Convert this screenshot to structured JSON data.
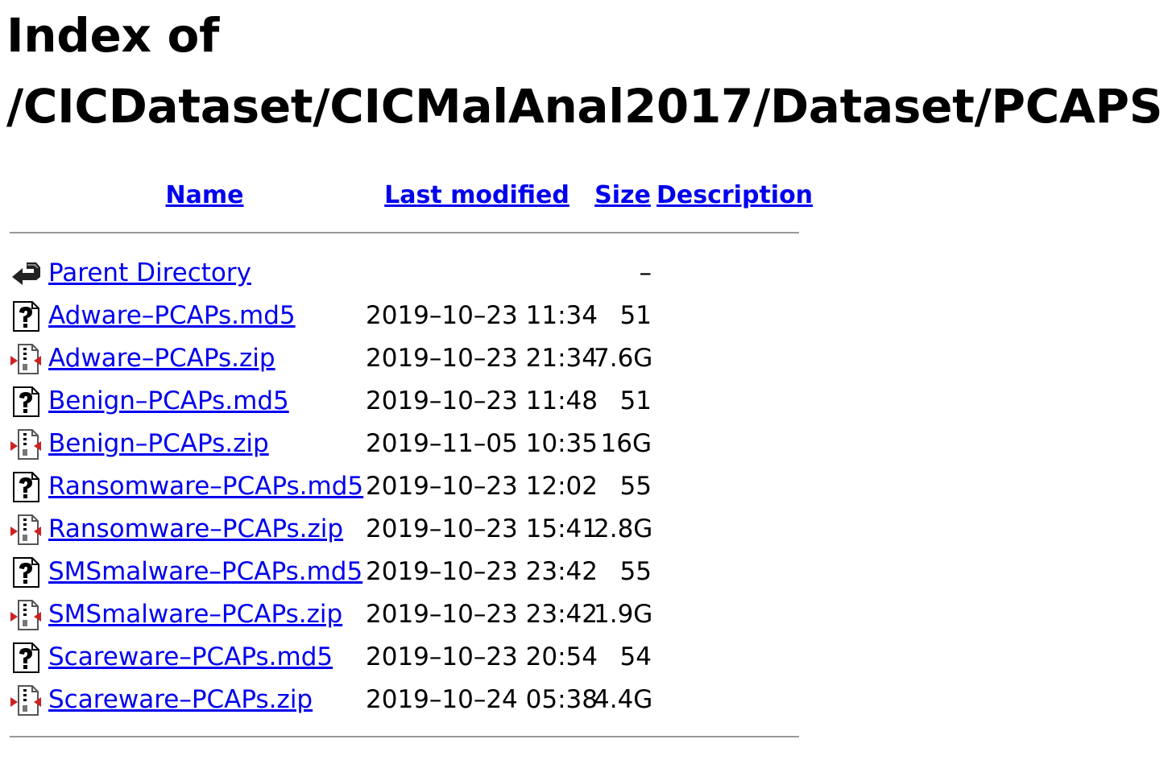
{
  "page": {
    "title_line1": "Index of",
    "title_line2": "/CICDataset/CICMalAnal2017/Dataset/PCAPS"
  },
  "columns": {
    "name": "Name",
    "last_modified": "Last modified",
    "size": "Size",
    "description": "Description"
  },
  "rows": [
    {
      "icon": "back-icon",
      "name": "Parent Directory",
      "date": "",
      "size": "–",
      "description": ""
    },
    {
      "icon": "unknown-file-icon",
      "name": "Adware–PCAPs.md5",
      "date": "2019–10–23 11:34",
      "size": "51",
      "description": ""
    },
    {
      "icon": "compressed-file-icon",
      "name": "Adware–PCAPs.zip",
      "date": "2019–10–23 21:34",
      "size": "7.6G",
      "description": ""
    },
    {
      "icon": "unknown-file-icon",
      "name": "Benign–PCAPs.md5",
      "date": "2019–10–23 11:48",
      "size": "51",
      "description": ""
    },
    {
      "icon": "compressed-file-icon",
      "name": "Benign–PCAPs.zip",
      "date": "2019–11–05 10:35",
      "size": "16G",
      "description": ""
    },
    {
      "icon": "unknown-file-icon",
      "name": "Ransomware–PCAPs.md5",
      "date": "2019–10–23 12:02",
      "size": "55",
      "description": ""
    },
    {
      "icon": "compressed-file-icon",
      "name": "Ransomware–PCAPs.zip",
      "date": "2019–10–23 15:41",
      "size": "2.8G",
      "description": ""
    },
    {
      "icon": "unknown-file-icon",
      "name": "SMSmalware–PCAPs.md5",
      "date": "2019–10–23 23:42",
      "size": "55",
      "description": ""
    },
    {
      "icon": "compressed-file-icon",
      "name": "SMSmalware–PCAPs.zip",
      "date": "2019–10–23 23:42",
      "size": "1.9G",
      "description": ""
    },
    {
      "icon": "unknown-file-icon",
      "name": "Scareware–PCAPs.md5",
      "date": "2019–10–23 20:54",
      "size": "54",
      "description": ""
    },
    {
      "icon": "compressed-file-icon",
      "name": "Scareware–PCAPs.zip",
      "date": "2019–10–24 05:38",
      "size": "4.4G",
      "description": ""
    }
  ],
  "colors": {
    "link": "#0000ee",
    "rule": "#999999",
    "zip_icon_accent": "#cc2222"
  }
}
